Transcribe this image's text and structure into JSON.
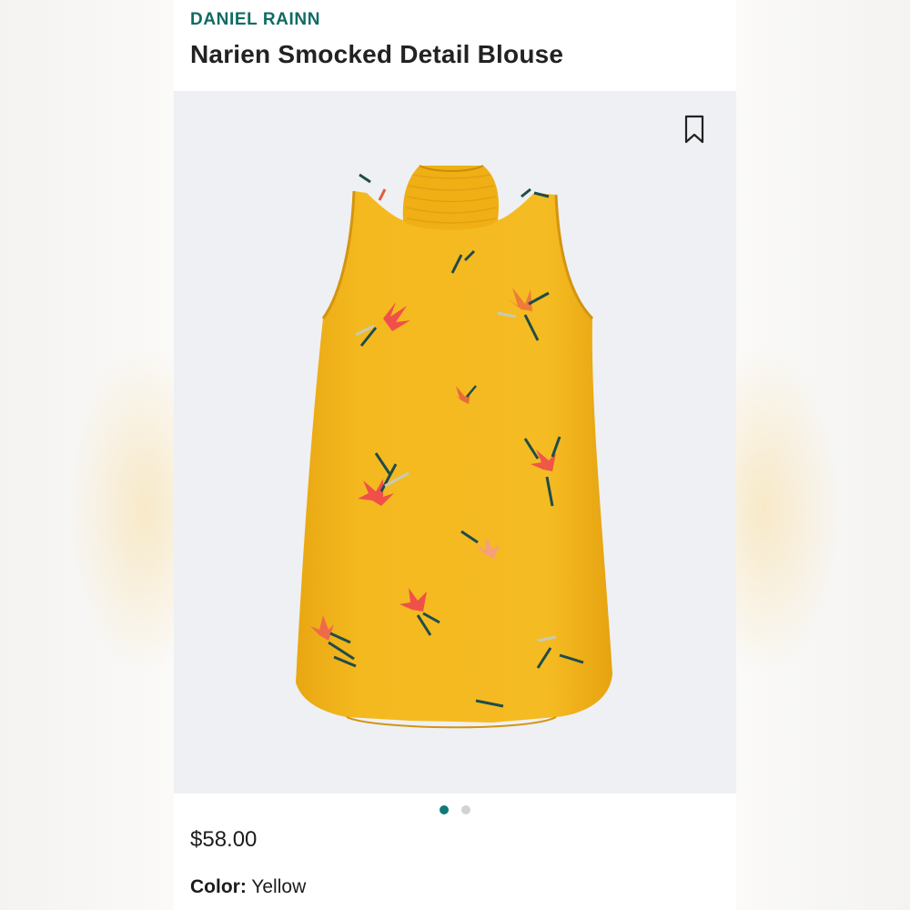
{
  "header": {
    "brand": "DANIEL RAINN",
    "title": "Narien Smocked Detail Blouse"
  },
  "image": {
    "bookmark_icon": "bookmark-outline-icon",
    "product_color": "#f3b61f",
    "carousel": {
      "total": 2,
      "active_index": 0,
      "active_color": "#0e7a76",
      "inactive_color": "#cfd3d6"
    }
  },
  "details": {
    "price": "$58.00",
    "color_label": "Color:",
    "color_value": "Yellow"
  }
}
